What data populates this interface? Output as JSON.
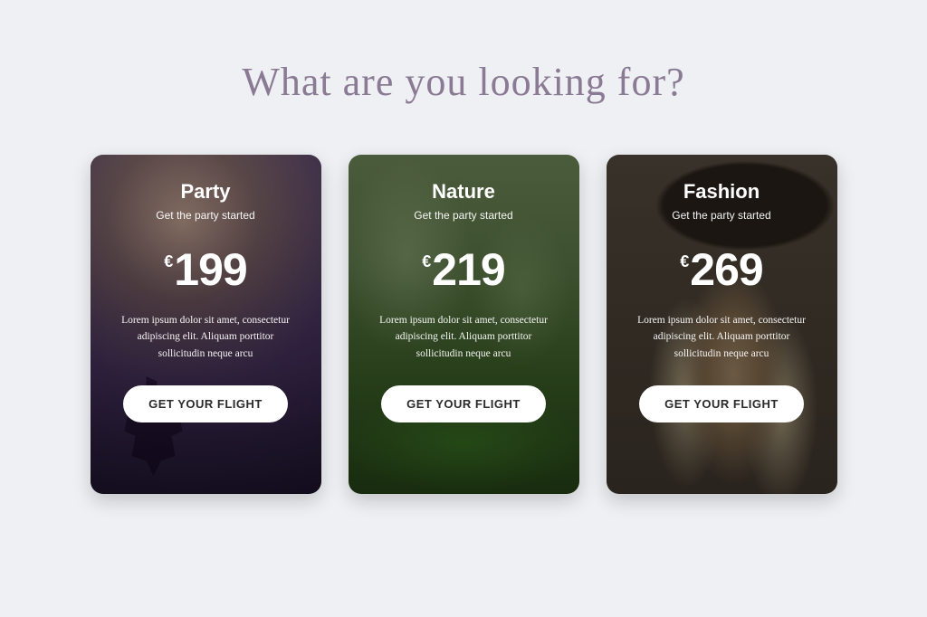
{
  "heading": "What are you looking for?",
  "cards": [
    {
      "title": "Party",
      "subtitle": "Get the party started",
      "currency": "€",
      "price": "199",
      "description": "Lorem ipsum dolor sit amet, consectetur adipiscing elit. Aliquam porttitor sollicitudin neque arcu",
      "button": "GET YOUR FLIGHT"
    },
    {
      "title": "Nature",
      "subtitle": "Get the party started",
      "currency": "€",
      "price": "219",
      "description": "Lorem ipsum dolor sit amet, consectetur adipiscing elit. Aliquam porttitor sollicitudin neque arcu",
      "button": "GET YOUR FLIGHT"
    },
    {
      "title": "Fashion",
      "subtitle": "Get the party started",
      "currency": "€",
      "price": "269",
      "description": "Lorem ipsum dolor sit amet, consectetur adipiscing elit. Aliquam porttitor sollicitudin neque arcu",
      "button": "GET YOUR FLIGHT"
    }
  ]
}
